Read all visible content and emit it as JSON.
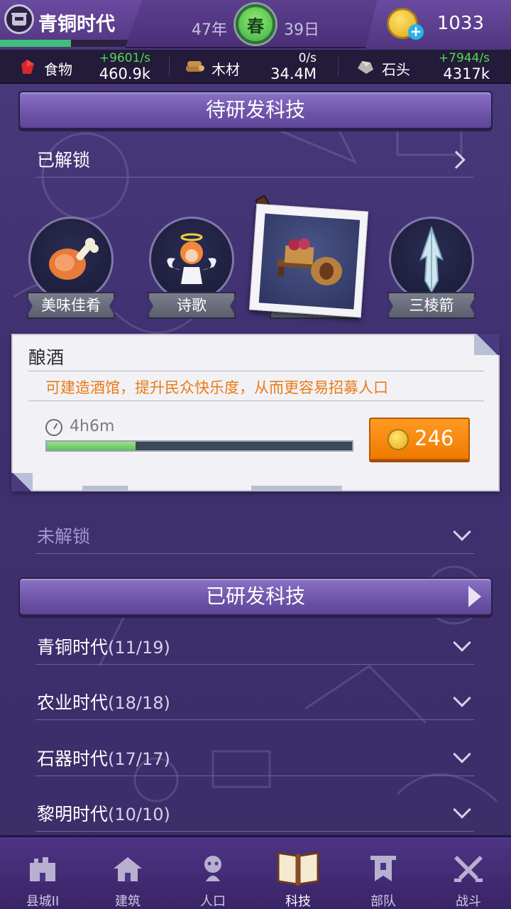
{
  "topbar": {
    "era_title": "青铜时代",
    "era_progress_fraction": 0.5,
    "year": "47年",
    "season": "春",
    "day": "39日",
    "gold": "1033",
    "gold_icon": "gold-coin-plus-icon"
  },
  "resources": [
    {
      "icon": "meat-food-icon",
      "name": "食物",
      "rate": "+9601/s",
      "total": "460.9k",
      "rate_color": "#4fdc4f"
    },
    {
      "icon": "wood-log-icon",
      "name": "木材",
      "rate": "0/s",
      "total": "34.4M",
      "rate_color": "#ffffff"
    },
    {
      "icon": "stone-icon",
      "name": "石头",
      "rate": "+7944/s",
      "total": "4317k",
      "rate_color": "#4fdc4f"
    }
  ],
  "pending": {
    "header": "待研发科技",
    "unlocked_label": "已解锁",
    "techs": [
      {
        "label": "美味佳肴",
        "icon": "roast-ham-icon"
      },
      {
        "label": "诗歌",
        "icon": "angel-poet-icon"
      },
      {
        "label": "",
        "icon": "brewery-barrel-cart-icon",
        "selected": true
      },
      {
        "label": "三棱箭",
        "icon": "arrowhead-icon"
      }
    ]
  },
  "detail": {
    "title": "酿酒",
    "description": "可建造酒馆，提升民众快乐度，从而更容易招募人口",
    "time": "4h6m",
    "progress_fraction": 0.29,
    "cost": "246",
    "cost_icon": "gold-coin-icon",
    "accent_color": "#f28a10"
  },
  "locked_label": "未解锁",
  "researched": {
    "header": "已研发科技",
    "eras": [
      {
        "name": "青铜时代",
        "count": "(11/19)"
      },
      {
        "name": "农业时代",
        "count": "(18/18)"
      },
      {
        "name": "石器时代",
        "count": "(17/17)"
      },
      {
        "name": "黎明时代",
        "count": "(10/10)"
      }
    ]
  },
  "nav": [
    {
      "label": "县城II",
      "icon": "castle-icon"
    },
    {
      "label": "建筑",
      "icon": "house-icon"
    },
    {
      "label": "人口",
      "icon": "person-icon"
    },
    {
      "label": "科技",
      "icon": "book-icon",
      "active": true
    },
    {
      "label": "部队",
      "icon": "banner-icon"
    },
    {
      "label": "战斗",
      "icon": "crossed-swords-icon"
    }
  ]
}
